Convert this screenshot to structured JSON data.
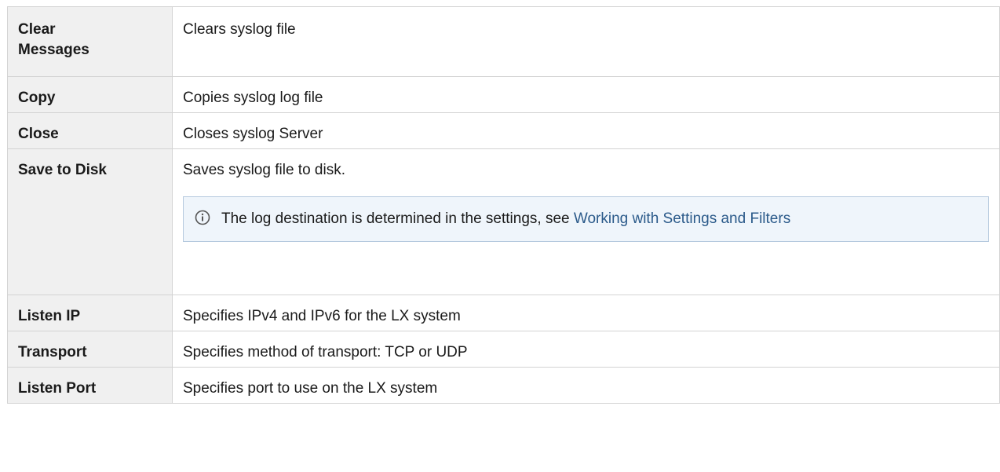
{
  "rows": [
    {
      "key": "Clear Messages",
      "value": "Clears syslog file"
    },
    {
      "key": "Copy",
      "value": "Copies syslog log file"
    },
    {
      "key": "Close",
      "value": "Closes syslog Server"
    },
    {
      "key": "Save to Disk",
      "value": "Saves syslog file to disk."
    },
    {
      "key": "Listen IP",
      "value": "Specifies IPv4 and IPv6 for the LX system"
    },
    {
      "key": "Transport",
      "value": "Specifies method of transport: TCP or UDP"
    },
    {
      "key": "Listen Port",
      "value": "Specifies port to use on the LX system"
    }
  ],
  "info": {
    "text": "The log destination is determined in the settings, see ",
    "link_text": "Working with Settings and Filters",
    "icon": "info-icon",
    "accent": "#2b5a8a",
    "background": "#eff5fb"
  },
  "clear_messages_line1": "Clear",
  "clear_messages_line2": "Messages"
}
